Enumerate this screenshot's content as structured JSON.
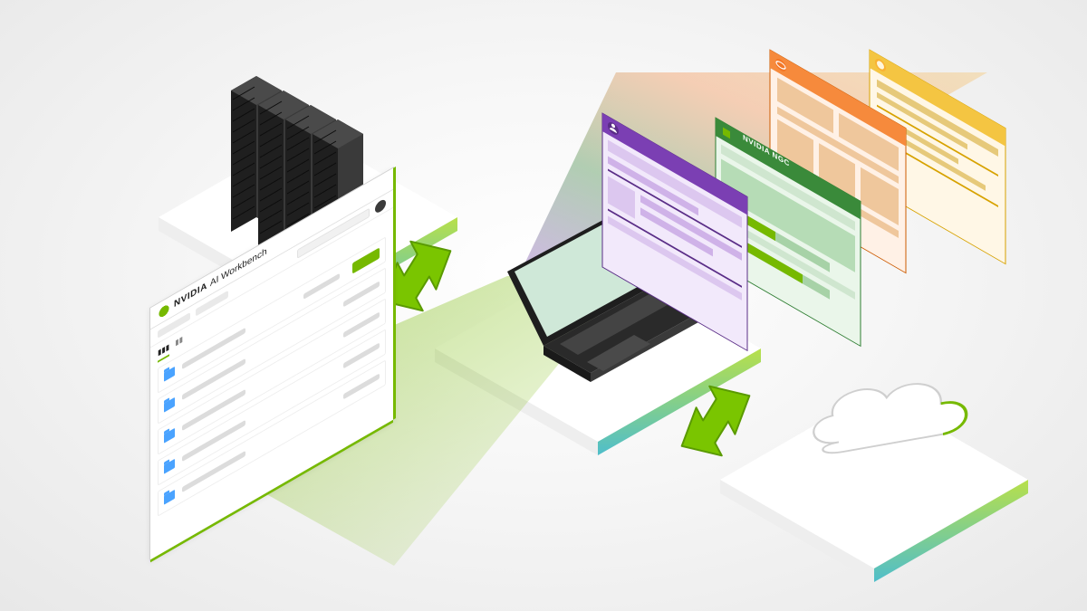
{
  "workbench_window": {
    "brand": "NVIDIA",
    "product": "AI Workbench",
    "list_rows": 5
  },
  "integration_windows": {
    "github": {
      "color": "#7b3fb3",
      "name": "github"
    },
    "ngc": {
      "color": "#2e7d32",
      "label": "NVIDIA NGC",
      "name": "ngc"
    },
    "jupyter": {
      "color": "#f37726",
      "name": "jupyter"
    },
    "huggingface": {
      "color": "#f9b233",
      "name": "huggingface"
    }
  },
  "nodes": {
    "server": "server-rack",
    "laptop": "laptop",
    "cloud": "cloud"
  },
  "accent": "#76b900"
}
